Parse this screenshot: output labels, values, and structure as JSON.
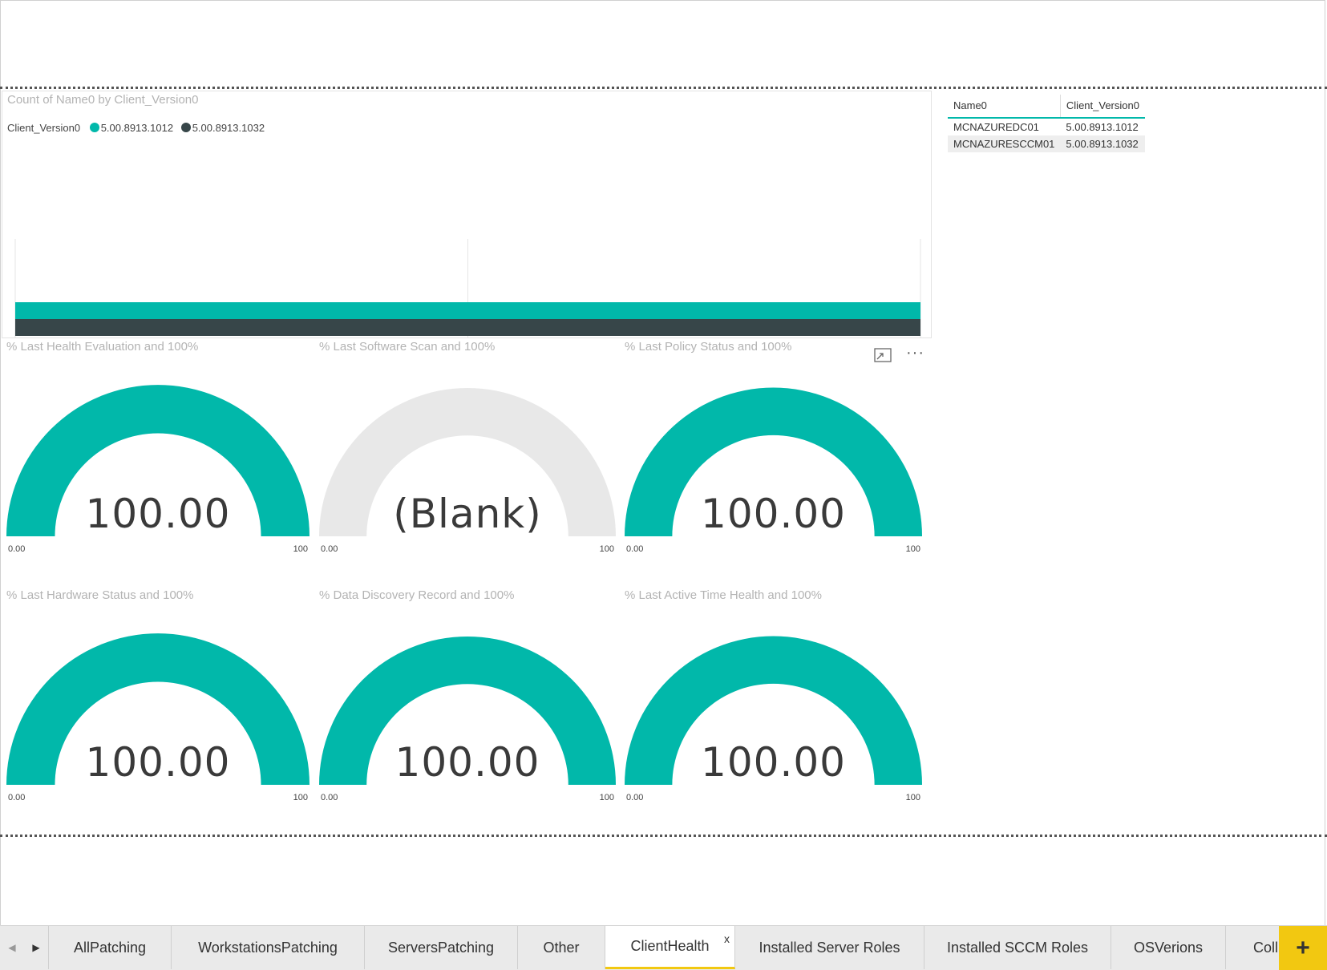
{
  "bar_chart": {
    "title": "Count of Name0 by Client_Version0",
    "legend_title": "Client_Version0",
    "colors": {
      "series1": "#01b8aa",
      "series2": "#374649"
    }
  },
  "chart_data": [
    {
      "type": "bar",
      "orientation": "horizontal",
      "title": "Count of Name0 by Client_Version0",
      "legend_title": "Client_Version0",
      "series": [
        {
          "name": "5.00.8913.1012",
          "values": [
            1
          ],
          "color": "#01b8aa"
        },
        {
          "name": "5.00.8913.1032",
          "values": [
            1
          ],
          "color": "#374649"
        }
      ],
      "xlim": [
        0,
        1
      ],
      "x_ticks": [
        "0.0",
        "0.5",
        "1.0"
      ],
      "grid": true,
      "legend": "top-left"
    }
  ],
  "table": {
    "headers": [
      "Name0",
      "Client_Version0"
    ],
    "rows": [
      [
        "MCNAZUREDC01",
        "5.00.8913.1012"
      ],
      [
        "MCNAZURESCCM01",
        "5.00.8913.1032"
      ]
    ]
  },
  "gauges": [
    {
      "title": "% Last Health Evaluation and 100%",
      "value_text": "100.00",
      "fill": 1.0,
      "min": "0.00",
      "max": "100"
    },
    {
      "title": "% Last Software Scan and 100%",
      "value_text": "(Blank)",
      "fill": 0.0,
      "min": "0.00",
      "max": "100"
    },
    {
      "title": "% Last Policy Status and 100%",
      "value_text": "100.00",
      "fill": 1.0,
      "min": "0.00",
      "max": "100"
    },
    {
      "title": "% Last Hardware Status and 100%",
      "value_text": "100.00",
      "fill": 1.0,
      "min": "0.00",
      "max": "100"
    },
    {
      "title": "% Data Discovery Record and 100%",
      "value_text": "100.00",
      "fill": 1.0,
      "min": "0.00",
      "max": "100"
    },
    {
      "title": "% Last Active Time Health and 100%",
      "value_text": "100.00",
      "fill": 1.0,
      "min": "0.00",
      "max": "100"
    }
  ],
  "gauge_colors": {
    "fill": "#01b8aa",
    "empty": "#e8e8e8"
  },
  "visual_header": {
    "focus_icon": "focus-mode-icon",
    "more_icon": "more-options-icon"
  },
  "tabs": {
    "items": [
      "AllPatching",
      "WorkstationsPatching",
      "ServersPatching",
      "Other",
      "ClientHealth",
      "Installed Server Roles",
      "Installed SCCM Roles",
      "OSVerions",
      "Coll"
    ],
    "active": "ClientHealth",
    "close_label": "x",
    "add_label": "+",
    "nav_left": "◀",
    "nav_right": "▶"
  }
}
